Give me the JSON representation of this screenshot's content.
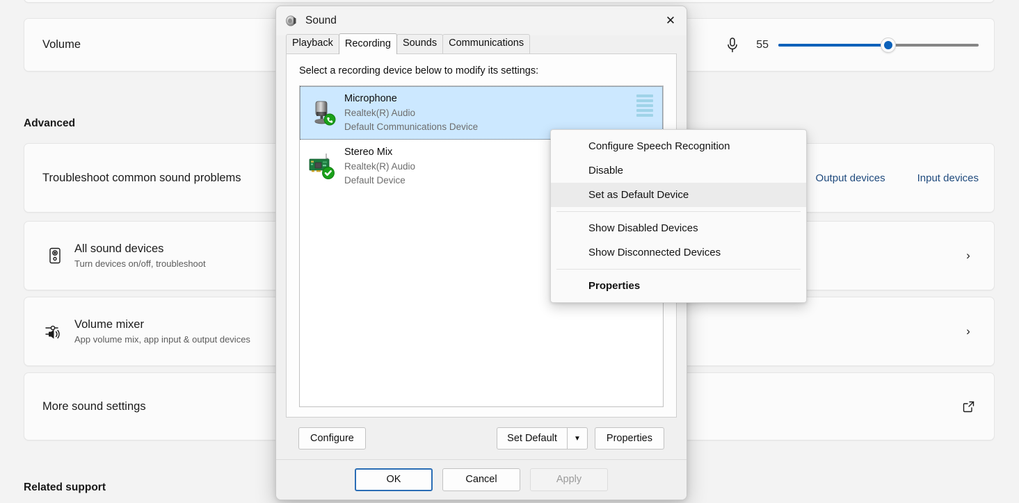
{
  "settings": {
    "volume_card": {
      "label": "Volume",
      "mic_icon": "microphone-icon",
      "value": "55",
      "slider_percent": 55
    },
    "advanced_heading": "Advanced",
    "troubleshoot_card": {
      "title": "Troubleshoot common sound problems",
      "links": [
        "Output devices",
        "Input devices"
      ]
    },
    "all_sound_devices": {
      "icon": "speaker-icon",
      "title": "All sound devices",
      "subtitle": "Turn devices on/off, troubleshoot",
      "chevron": "›"
    },
    "volume_mixer": {
      "icon": "volume-mixer-icon",
      "title": "Volume mixer",
      "subtitle": "App volume mix, app input & output devices",
      "chevron": "›"
    },
    "more_sound_settings": {
      "title": "More sound settings",
      "icon": "external-link-icon"
    },
    "related_support_heading": "Related support"
  },
  "dialog": {
    "title": "Sound",
    "title_icon": "speaker-icon",
    "close_label": "✕",
    "tabs": [
      {
        "label": "Playback",
        "active": false
      },
      {
        "label": "Recording",
        "active": true
      },
      {
        "label": "Sounds",
        "active": false
      },
      {
        "label": "Communications",
        "active": false
      }
    ],
    "prompt": "Select a recording device below to modify its settings:",
    "devices": [
      {
        "name": "Microphone",
        "description": "Realtek(R) Audio",
        "status": "Default Communications Device",
        "icon": "microphone-device-icon",
        "badge": "green-phone-badge",
        "selected": true,
        "meter_bars": 5
      },
      {
        "name": "Stereo Mix",
        "description": "Realtek(R) Audio",
        "status": "Default Device",
        "icon": "sound-card-icon",
        "badge": "green-check-badge",
        "selected": false,
        "meter_bars": 0
      }
    ],
    "buttons": {
      "configure": "Configure",
      "set_default": "Set Default",
      "set_default_arrow": "▼",
      "properties": "Properties"
    },
    "footer": {
      "ok": "OK",
      "cancel": "Cancel",
      "apply": "Apply",
      "apply_disabled": true
    }
  },
  "context_menu": {
    "items": [
      {
        "label": "Configure Speech Recognition",
        "hover": false,
        "bold": false,
        "separator_after": false
      },
      {
        "label": "Disable",
        "hover": false,
        "bold": false,
        "separator_after": false
      },
      {
        "label": "Set as Default Device",
        "hover": true,
        "bold": false,
        "separator_after": true
      },
      {
        "label": "Show Disabled Devices",
        "hover": false,
        "bold": false,
        "separator_after": false
      },
      {
        "label": "Show Disconnected Devices",
        "hover": false,
        "bold": false,
        "separator_after": true
      },
      {
        "label": "Properties",
        "hover": false,
        "bold": true,
        "separator_after": false
      }
    ]
  },
  "colors": {
    "accent": "#0b61ba",
    "link": "#1f4a7d",
    "selection": "#cce8ff",
    "green_badge": "#1aa01a"
  }
}
